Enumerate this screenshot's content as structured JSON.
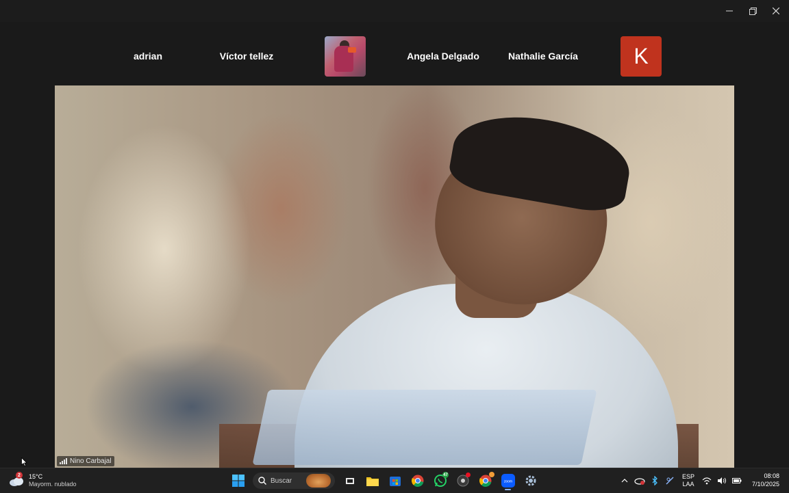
{
  "participants_strip": {
    "names": [
      "adrian",
      "Víctor tellez",
      "Angela Delgado",
      "Nathalie García"
    ],
    "avatar_letter": "K",
    "avatar_color": "#c0331e"
  },
  "main_video": {
    "speaker_name": "Nino Carbajal"
  },
  "taskbar": {
    "weather": {
      "badge_count": "2",
      "temperature": "15°C",
      "condition": "Mayorm. nublado"
    },
    "search_placeholder": "Buscar",
    "whatsapp_badge": "47",
    "language": {
      "line1": "ESP",
      "line2": "LAA"
    },
    "clock": {
      "time": "08:08",
      "date": "7/10/2025"
    }
  },
  "window_controls": {
    "icons": [
      "minimize-icon",
      "restore-icon",
      "close-icon"
    ]
  }
}
